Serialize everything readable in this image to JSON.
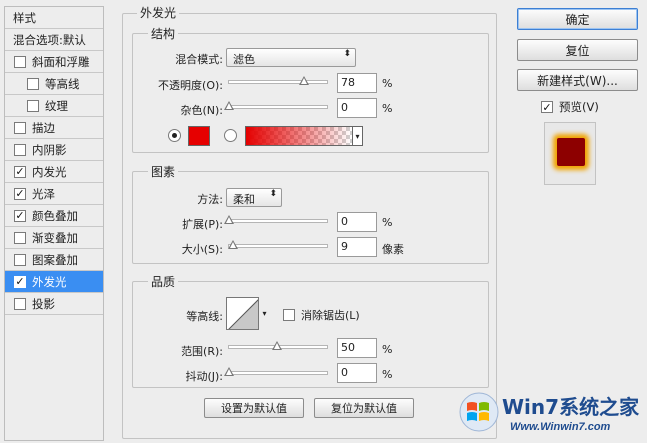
{
  "left_panel": {
    "header": "样式",
    "blending_options": "混合选项:默认",
    "items": [
      {
        "label": "斜面和浮雕",
        "checked": false
      },
      {
        "label": "等高线",
        "checked": false
      },
      {
        "label": "纹理",
        "checked": false
      },
      {
        "label": "描边",
        "checked": false
      },
      {
        "label": "内阴影",
        "checked": false
      },
      {
        "label": "内发光",
        "checked": true
      },
      {
        "label": "光泽",
        "checked": true
      },
      {
        "label": "颜色叠加",
        "checked": true
      },
      {
        "label": "渐变叠加",
        "checked": false
      },
      {
        "label": "图案叠加",
        "checked": false
      },
      {
        "label": "外发光",
        "checked": true,
        "selected": true
      },
      {
        "label": "投影",
        "checked": false
      }
    ],
    "check_mark": "✓"
  },
  "outer_glow": {
    "title": "外发光",
    "structure": {
      "title": "结构",
      "blend_mode_label": "混合模式:",
      "blend_mode_value": "滤色",
      "opacity_label": "不透明度(O):",
      "opacity_value": "78",
      "opacity_level": 78,
      "noise_label": "杂色(N):",
      "noise_value": "0",
      "noise_level": 0,
      "percent": "%",
      "color_solid": "#e60000"
    },
    "elements": {
      "title": "图素",
      "method_label": "方法:",
      "method_value": "柔和",
      "spread_label": "扩展(P):",
      "spread_value": "0",
      "spread_level": 0,
      "size_label": "大小(S):",
      "size_value": "9",
      "size_level": 4,
      "percent": "%",
      "size_unit": "像素"
    },
    "quality": {
      "title": "品质",
      "contour_label": "等高线:",
      "antialias_label": "消除锯齿(L)",
      "range_label": "范围(R):",
      "range_value": "50",
      "range_level": 50,
      "jitter_label": "抖动(J):",
      "jitter_value": "0",
      "jitter_level": 0,
      "percent": "%"
    },
    "set_default": "设置为默认值",
    "reset_default": "复位为默认值"
  },
  "right_panel": {
    "ok": "确定",
    "reset": "复位",
    "new_style": "新建样式(W)...",
    "preview_label": "预览(V)",
    "preview_checked": true
  },
  "watermark": {
    "title": "Win7系统之家",
    "url": "Www.Winwin7.com"
  },
  "arrows": {
    "updown": "⬍",
    "down": "▾"
  },
  "colors": {
    "selection": "#3a8ef2",
    "glow_inner": "#8d0000",
    "glow_outer": "#f1a400"
  }
}
